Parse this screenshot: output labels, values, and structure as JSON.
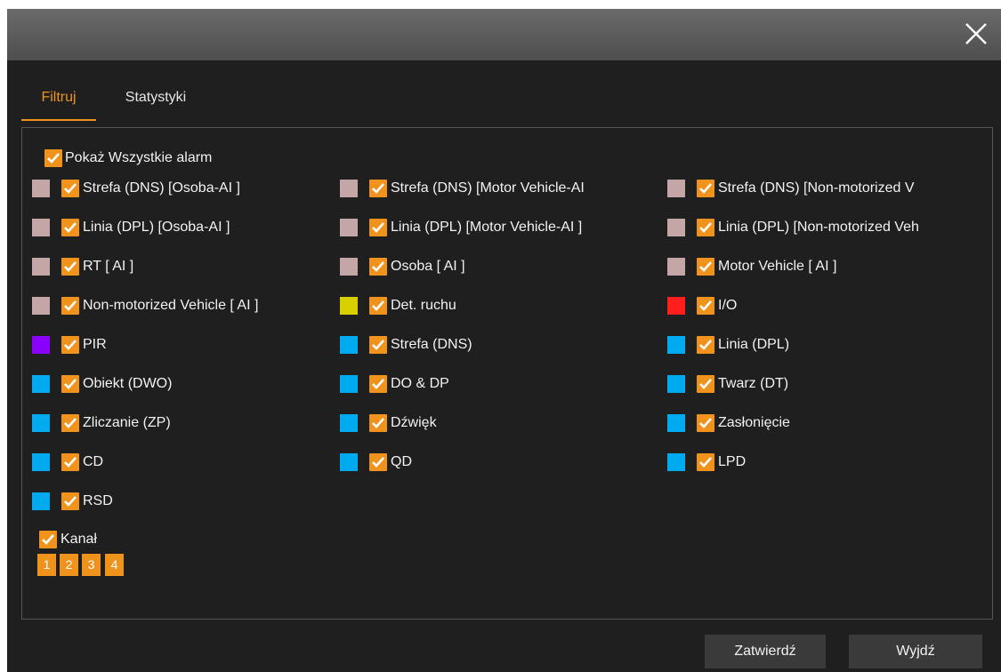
{
  "dialog": {
    "tabs": [
      {
        "label": "Filtruj",
        "active": true
      },
      {
        "label": "Statystyki",
        "active": false
      }
    ],
    "show_all": {
      "label": "Pokaż Wszystkie alarm",
      "checked": true
    },
    "alarm_rows": [
      [
        {
          "label": "Strefa (DNS) [Osoba-AI ]",
          "color": "#c4a6a6",
          "checked": true
        },
        {
          "label": "Strefa (DNS) [Motor Vehicle-AI",
          "color": "#c4a6a6",
          "checked": true
        },
        {
          "label": "Strefa (DNS) [Non-motorized V",
          "color": "#c4a6a6",
          "checked": true
        }
      ],
      [
        {
          "label": "Linia (DPL) [Osoba-AI ]",
          "color": "#c4a6a6",
          "checked": true
        },
        {
          "label": "Linia (DPL) [Motor Vehicle-AI ]",
          "color": "#c4a6a6",
          "checked": true
        },
        {
          "label": "Linia (DPL) [Non-motorized Veh",
          "color": "#c4a6a6",
          "checked": true
        }
      ],
      [
        {
          "label": "RT  [ AI ]",
          "color": "#c4a6a6",
          "checked": true
        },
        {
          "label": "Osoba  [ AI ]",
          "color": "#c4a6a6",
          "checked": true
        },
        {
          "label": "Motor Vehicle  [ AI ]",
          "color": "#c4a6a6",
          "checked": true
        }
      ],
      [
        {
          "label": "Non-motorized Vehicle  [ AI ]",
          "color": "#c4a6a6",
          "checked": true
        },
        {
          "label": "Det. ruchu",
          "color": "#d8d000",
          "checked": true
        },
        {
          "label": "I/O",
          "color": "#ff1e1e",
          "checked": true
        }
      ],
      [
        {
          "label": "PIR",
          "color": "#8a00ff",
          "checked": true
        },
        {
          "label": "Strefa (DNS)",
          "color": "#00aaee",
          "checked": true
        },
        {
          "label": "Linia (DPL)",
          "color": "#00aaee",
          "checked": true
        }
      ],
      [
        {
          "label": "Obiekt (DWO)",
          "color": "#00aaee",
          "checked": true
        },
        {
          "label": "DO & DP",
          "color": "#00aaee",
          "checked": true
        },
        {
          "label": "Twarz (DT)",
          "color": "#00aaee",
          "checked": true
        }
      ],
      [
        {
          "label": "Zliczanie (ZP)",
          "color": "#00aaee",
          "checked": true
        },
        {
          "label": "Dźwięk",
          "color": "#00aaee",
          "checked": true
        },
        {
          "label": "Zasłonięcie",
          "color": "#00aaee",
          "checked": true
        }
      ],
      [
        {
          "label": "CD",
          "color": "#00aaee",
          "checked": true
        },
        {
          "label": "QD",
          "color": "#00aaee",
          "checked": true
        },
        {
          "label": "LPD",
          "color": "#00aaee",
          "checked": true
        }
      ],
      [
        {
          "label": "RSD",
          "color": "#00aaee",
          "checked": true
        }
      ]
    ],
    "channel": {
      "label": "Kanał",
      "checked": true,
      "numbers": [
        "1",
        "2",
        "3",
        "4"
      ]
    },
    "buttons": {
      "confirm": "Zatwierdź",
      "exit": "Wyjdź"
    },
    "colors": {
      "accent": "#f0931c",
      "background": "#1f1f1f",
      "titlebar": "#5a5a5a"
    },
    "icons": {
      "close": "close-icon",
      "check": "check-icon"
    }
  }
}
